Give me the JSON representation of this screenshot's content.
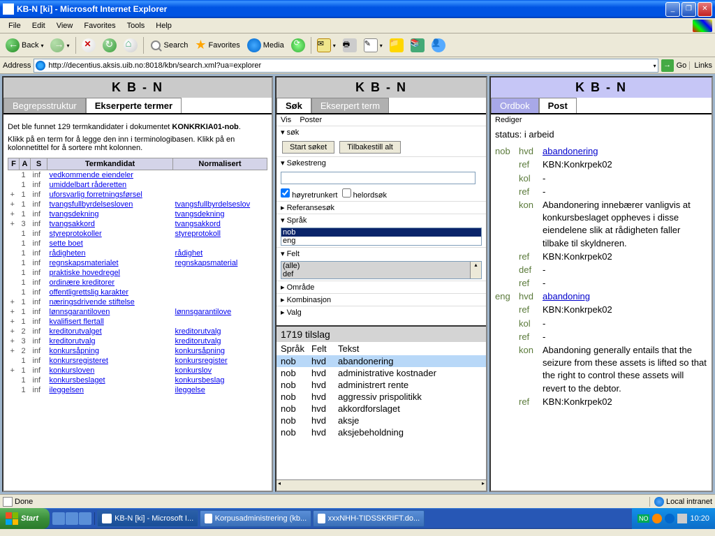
{
  "window": {
    "title": "KB-N [ki] - Microsoft Internet Explorer"
  },
  "menubar": [
    "File",
    "Edit",
    "View",
    "Favorites",
    "Tools",
    "Help"
  ],
  "toolbar": {
    "back": "Back",
    "search": "Search",
    "favorites": "Favorites",
    "media": "Media"
  },
  "addressbar": {
    "label": "Address",
    "url": "http://decentius.aksis.uib.no:8018/kbn/search.xml?ua=explorer",
    "go": "Go",
    "links": "Links"
  },
  "pane1": {
    "header": "K B - N",
    "tabs": {
      "inactive": "Begrepsstruktur",
      "active": "Ekserperte termer"
    },
    "text1a": "Det ble funnet 129 termkandidater i dokumentet ",
    "text1b": "KONKRKIA01-nob",
    "text1c": ".",
    "text2": "Klikk på en term for å legge den inn i terminologibasen. Klikk på en kolonnetittel for å sortere mht kolonnen.",
    "cols": {
      "f": "F",
      "a": "A",
      "s": "S",
      "termkandidat": "Termkandidat",
      "normalisert": "Normalisert"
    },
    "rows": [
      {
        "f": "",
        "a": "1",
        "s": "inf",
        "t": "vedkommende eiendeler",
        "n": ""
      },
      {
        "f": "",
        "a": "1",
        "s": "inf",
        "t": "umiddelbart råderetten",
        "n": ""
      },
      {
        "f": "+",
        "a": "1",
        "s": "inf",
        "t": "uforsvarlig forretningsførsel",
        "n": ""
      },
      {
        "f": "+",
        "a": "1",
        "s": "inf",
        "t": "tvangsfullbyrdelsesloven",
        "n": "tvangsfullbyrdelseslov"
      },
      {
        "f": "+",
        "a": "1",
        "s": "inf",
        "t": "tvangsdekning",
        "n": "tvangsdekning"
      },
      {
        "f": "+",
        "a": "3",
        "s": "inf",
        "t": "tvangsakkord",
        "n": "tvangsakkord"
      },
      {
        "f": "",
        "a": "1",
        "s": "inf",
        "t": "styreprotokoller",
        "n": "styreprotokoll"
      },
      {
        "f": "",
        "a": "1",
        "s": "inf",
        "t": "sette boet",
        "n": ""
      },
      {
        "f": "",
        "a": "1",
        "s": "inf",
        "t": "rådigheten",
        "n": "rådighet"
      },
      {
        "f": "",
        "a": "1",
        "s": "inf",
        "t": "regnskapsmaterialet",
        "n": "regnskapsmaterial"
      },
      {
        "f": "",
        "a": "1",
        "s": "inf",
        "t": "praktiske hovedregel",
        "n": ""
      },
      {
        "f": "",
        "a": "1",
        "s": "inf",
        "t": "ordinære kreditorer",
        "n": ""
      },
      {
        "f": "",
        "a": "1",
        "s": "inf",
        "t": "offentligrettslig karakter",
        "n": ""
      },
      {
        "f": "+",
        "a": "1",
        "s": "inf",
        "t": "næringsdrivende stiftelse",
        "n": ""
      },
      {
        "f": "+",
        "a": "1",
        "s": "inf",
        "t": "lønnsgarantiloven",
        "n": "lønnsgarantilove"
      },
      {
        "f": "+",
        "a": "1",
        "s": "inf",
        "t": "kvalifisert flertall",
        "n": ""
      },
      {
        "f": "+",
        "a": "2",
        "s": "inf",
        "t": "kreditorutvalget",
        "n": "kreditorutvalg"
      },
      {
        "f": "+",
        "a": "3",
        "s": "inf",
        "t": "kreditorutvalg",
        "n": "kreditorutvalg"
      },
      {
        "f": "+",
        "a": "2",
        "s": "inf",
        "t": "konkursåpning",
        "n": "konkursåpning"
      },
      {
        "f": "",
        "a": "1",
        "s": "inf",
        "t": "konkursregisteret",
        "n": "konkursregister"
      },
      {
        "f": "+",
        "a": "1",
        "s": "inf",
        "t": "konkursloven",
        "n": "konkurslov"
      },
      {
        "f": "",
        "a": "1",
        "s": "inf",
        "t": "konkursbeslaget",
        "n": "konkursbeslag"
      },
      {
        "f": "",
        "a": "1",
        "s": "inf",
        "t": "ileggelsen",
        "n": "ileggelse"
      }
    ]
  },
  "pane2": {
    "header": "K B - N",
    "tabs": {
      "active": "Søk",
      "inactive": "Ekserpert term"
    },
    "sub": {
      "vis": "Vis",
      "poster": "Poster"
    },
    "sok": "søk",
    "buttons": {
      "start": "Start søket",
      "reset": "Tilbakestill alt"
    },
    "sections": {
      "sokestreng": "Søkestreng",
      "hoyretrunkert": "høyretrunkert",
      "helordsok": "helordsøk",
      "referansesok": "Referansesøk",
      "sprak": "Språk",
      "felt": "Felt",
      "omrade": "Område",
      "kombinasjon": "Kombinasjon",
      "valg": "Valg"
    },
    "sprak_opts": [
      "nob",
      "eng"
    ],
    "felt_opts": [
      "(alle)",
      "def"
    ],
    "hits": {
      "count": "1719 tilslag",
      "cols": {
        "sprak": "Språk",
        "felt": "Felt",
        "tekst": "Tekst"
      },
      "rows": [
        {
          "s": "nob",
          "f": "hvd",
          "t": "abandonering",
          "sel": true
        },
        {
          "s": "nob",
          "f": "hvd",
          "t": "administrative kostnader"
        },
        {
          "s": "nob",
          "f": "hvd",
          "t": "administrert rente"
        },
        {
          "s": "nob",
          "f": "hvd",
          "t": "aggressiv prispolitikk"
        },
        {
          "s": "nob",
          "f": "hvd",
          "t": "akkordforslaget"
        },
        {
          "s": "nob",
          "f": "hvd",
          "t": "aksje"
        },
        {
          "s": "nob",
          "f": "hvd",
          "t": "aksjebeholdning"
        }
      ]
    }
  },
  "pane3": {
    "header": "K B - N",
    "tabs": {
      "inactive": "Ordbok",
      "active": "Post"
    },
    "rediger": "Rediger",
    "status": "status: i arbeid",
    "entries": [
      {
        "lang": "nob",
        "lab": "hvd",
        "val": "abandonering",
        "link": true
      },
      {
        "lang": "",
        "lab": "ref",
        "val": "KBN:Konkrpek02"
      },
      {
        "lang": "",
        "lab": "kol",
        "val": "-"
      },
      {
        "lang": "",
        "lab": "ref",
        "val": "-"
      },
      {
        "lang": "",
        "lab": "kon",
        "val": "Abandonering innebærer vanligvis at konkursbeslaget oppheves i disse eiendelene slik at rådigheten faller tilbake til skyldneren."
      },
      {
        "lang": "",
        "lab": "ref",
        "val": "KBN:Konkrpek02"
      },
      {
        "lang": "",
        "lab": "def",
        "val": "-"
      },
      {
        "lang": "",
        "lab": "ref",
        "val": "-"
      },
      {
        "lang": "eng",
        "lab": "hvd",
        "val": "abandoning",
        "link": true
      },
      {
        "lang": "",
        "lab": "ref",
        "val": "KBN:Konkrpek02"
      },
      {
        "lang": "",
        "lab": "kol",
        "val": "-"
      },
      {
        "lang": "",
        "lab": "ref",
        "val": "-"
      },
      {
        "lang": "",
        "lab": "kon",
        "val": "Abandoning generally entails that the seizure from these assets is lifted so that the right to control these assets will revert to the debtor."
      },
      {
        "lang": "",
        "lab": "ref",
        "val": "KBN:Konkrpek02"
      }
    ]
  },
  "statusbar": {
    "done": "Done",
    "zone": "Local intranet"
  },
  "taskbar": {
    "start": "Start",
    "items": [
      {
        "label": "KB-N [ki] - Microsoft I...",
        "active": true
      },
      {
        "label": "Korpusadministrering (kb..."
      },
      {
        "label": "xxxNHH-TIDSSKRIFT.do..."
      }
    ],
    "clock": "10:20",
    "tray_no": "NO"
  }
}
